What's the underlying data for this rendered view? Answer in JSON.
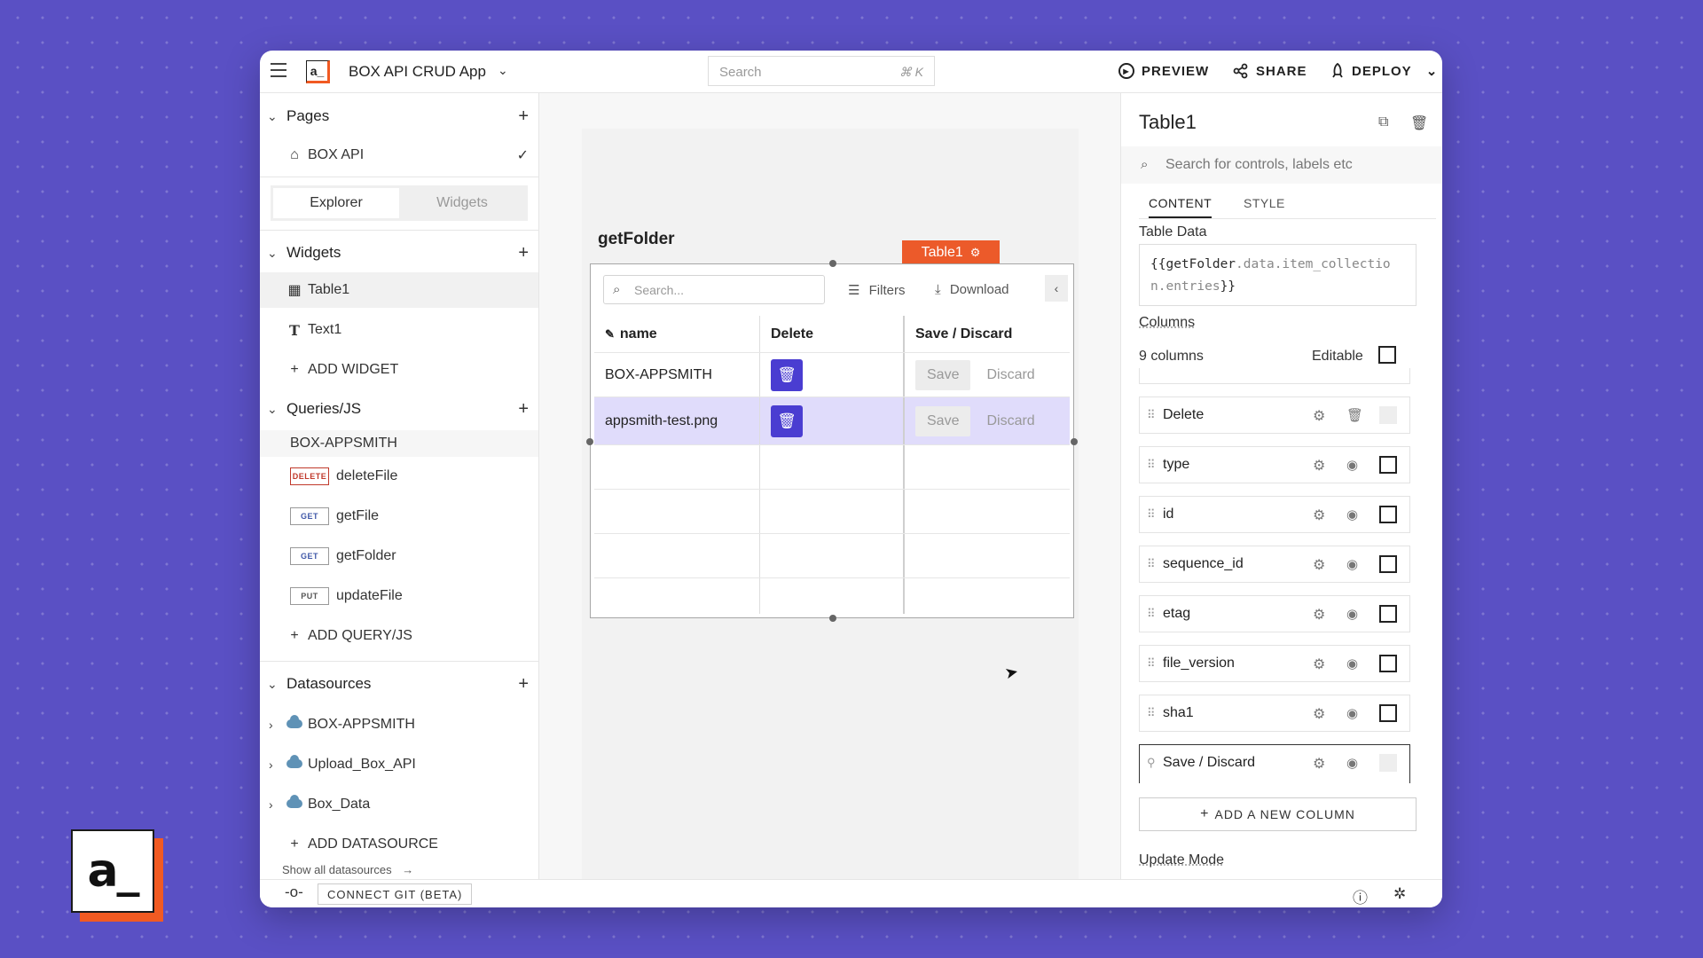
{
  "app": {
    "name": "BOX API CRUD App",
    "search_placeholder": "Search",
    "search_shortcut": "⌘ K",
    "preview_label": "PREVIEW",
    "share_label": "SHARE",
    "deploy_label": "DEPLOY"
  },
  "sidebar": {
    "pages_title": "Pages",
    "pages": [
      {
        "label": "BOX API"
      }
    ],
    "tabs": {
      "explorer": "Explorer",
      "widgets": "Widgets"
    },
    "widgets_title": "Widgets",
    "widgets": [
      {
        "label": "Table1",
        "icon": "table-icon"
      },
      {
        "label": "Text1",
        "icon": "text-icon"
      }
    ],
    "add_widget": "ADD WIDGET",
    "queries_title": "Queries/JS",
    "query_group": "BOX-APPSMITH",
    "queries": [
      {
        "method": "DELETE",
        "label": "deleteFile"
      },
      {
        "method": "GET",
        "label": "getFile"
      },
      {
        "method": "GET",
        "label": "getFolder"
      },
      {
        "method": "PUT",
        "label": "updateFile"
      }
    ],
    "add_query": "ADD QUERY/JS",
    "datasources_title": "Datasources",
    "datasources": [
      {
        "label": "BOX-APPSMITH"
      },
      {
        "label": "Upload_Box_API"
      },
      {
        "label": "Box_Data"
      }
    ],
    "add_datasource": "ADD DATASOURCE",
    "show_all": "Show all datasources"
  },
  "canvas": {
    "widget_title": "getFolder",
    "selected_tag": "Table1",
    "table": {
      "search_placeholder": "Search...",
      "filters_label": "Filters",
      "download_label": "Download",
      "headers": [
        "name",
        "Delete",
        "Save / Discard"
      ],
      "rows": [
        {
          "name": "BOX-APPSMITH",
          "save": "Save",
          "discard": "Discard"
        },
        {
          "name": "appsmith-test.png",
          "save": "Save",
          "discard": "Discard"
        }
      ]
    }
  },
  "properties": {
    "title": "Table1",
    "search_placeholder": "Search for controls, labels etc",
    "tabs": {
      "content": "CONTENT",
      "style": "STYLE"
    },
    "table_data_label": "Table Data",
    "table_data_open": "{{",
    "table_data_q": "getFolder",
    "table_data_p1": ".data",
    "table_data_p2": ".item_collection",
    "table_data_p3": ".entries",
    "table_data_close": "}}",
    "columns_label": "Columns",
    "columns_count": "9 columns",
    "editable_label": "Editable",
    "columns": [
      {
        "name": "Delete",
        "action": "trash"
      },
      {
        "name": "type",
        "action": "eye"
      },
      {
        "name": "id",
        "action": "eye"
      },
      {
        "name": "sequence_id",
        "action": "eye"
      },
      {
        "name": "etag",
        "action": "eye"
      },
      {
        "name": "file_version",
        "action": "eye"
      },
      {
        "name": "sha1",
        "action": "eye"
      },
      {
        "name": "Save / Discard",
        "action": "eye"
      }
    ],
    "add_column": "ADD A NEW COLUMN",
    "update_mode_label": "Update Mode"
  },
  "bottom": {
    "git_label": "CONNECT GIT (BETA)"
  },
  "colors": {
    "accent": "#4a3dd1",
    "selected_tag": "#ec5a2a",
    "background": "#5a50c4",
    "row_selected": "#e0dcfb"
  }
}
